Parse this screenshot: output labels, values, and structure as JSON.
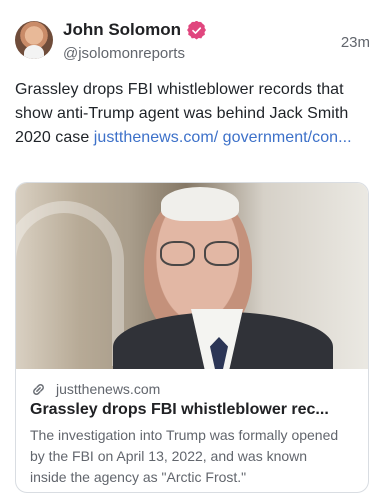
{
  "author": {
    "display_name": "John Solomon",
    "handle": "@jsolomonreports",
    "verified": true,
    "verified_color": "#e0467e"
  },
  "post": {
    "timestamp": "23m",
    "text": "Grassley drops FBI whistleblower records that show anti-Trump agent was behind Jack Smith 2020 case ",
    "link_text": "justthenews.com/ government/con..."
  },
  "link_card": {
    "domain": "justthenews.com",
    "title": "Grassley drops FBI whistleblower rec...",
    "description": "The investigation into Trump was formally opened by the FBI on April 13, 2022, and was known inside the agency as \"Arctic Frost.\"",
    "icon": "link-icon"
  },
  "colors": {
    "link": "#3d71c9",
    "secondary_text": "#62666d",
    "primary_text": "#1f2328",
    "card_border": "#d9dde2"
  }
}
